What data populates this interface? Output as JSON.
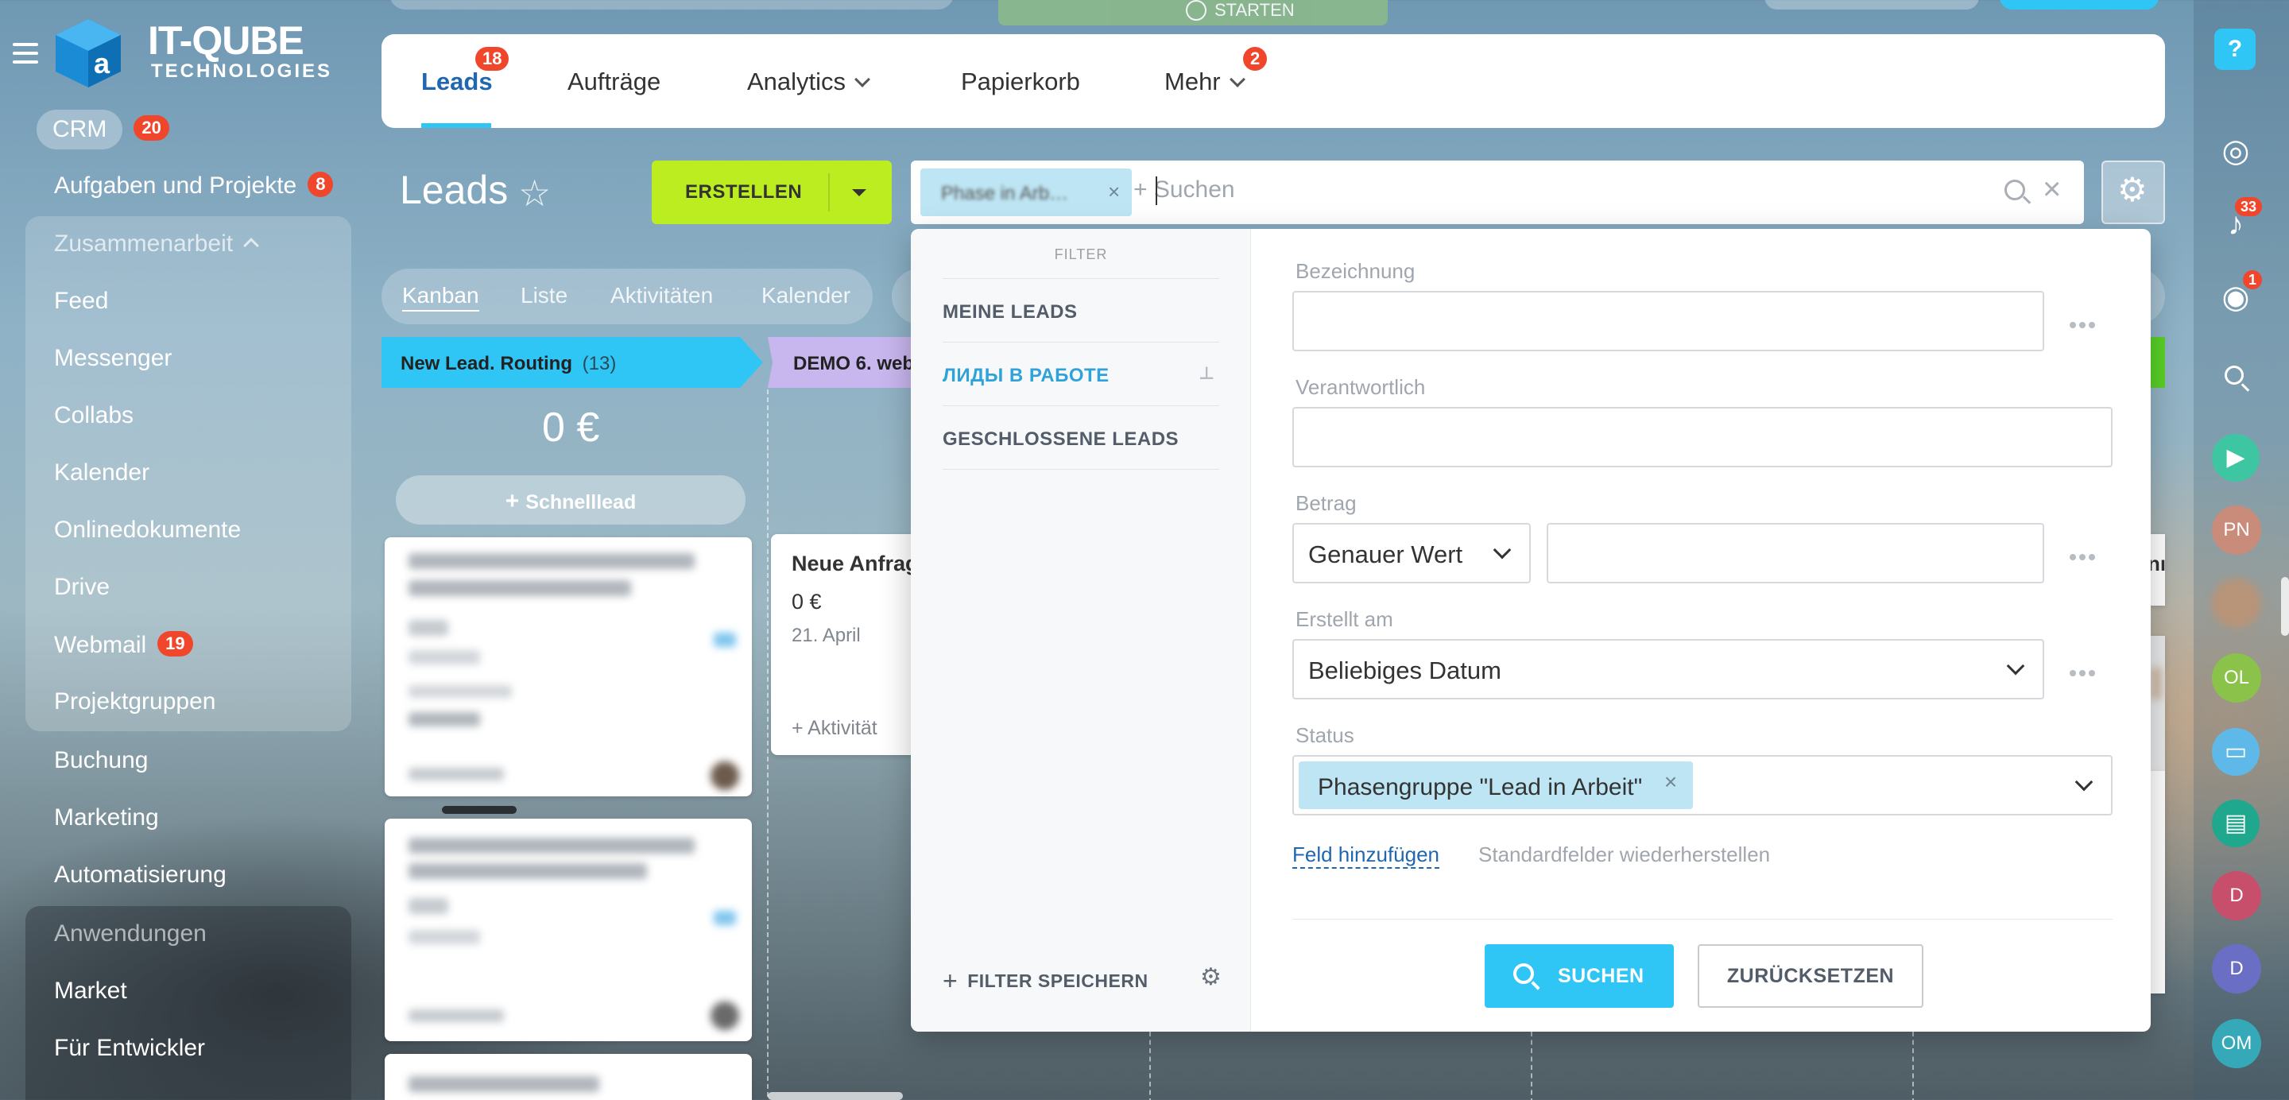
{
  "logo": {
    "name": "IT-QUBE",
    "sub": "TECHNOLOGIES"
  },
  "top_partial": {
    "timer_text": "STARTEN"
  },
  "sidebar": {
    "crm": {
      "label": "CRM",
      "badge": "20"
    },
    "tasks": {
      "label": "Aufgaben und Projekte",
      "badge": "8"
    },
    "group1_title": "Zusammenarbeit",
    "group1": [
      "Feed",
      "Messenger",
      "Collabs",
      "Kalender",
      "Onlinedokumente",
      "Drive"
    ],
    "webmail": {
      "label": "Webmail",
      "badge": "19"
    },
    "projektgruppen": "Projektgruppen",
    "buchung": "Buchung",
    "marketing": "Marketing",
    "automatisierung": "Automatisierung",
    "group2_title": "Anwendungen",
    "market": "Market",
    "entwickler": "Für Entwickler"
  },
  "topnav": {
    "tabs": [
      {
        "label": "Leads",
        "badge": "18"
      },
      {
        "label": "Aufträge"
      },
      {
        "label": "Analytics"
      },
      {
        "label": "Papierkorb"
      },
      {
        "label": "Mehr",
        "badge": "2"
      }
    ]
  },
  "toolbar": {
    "title": "Leads",
    "create_label": "ERSTELLEN",
    "search_chip": "Phase in Arb…",
    "search_placeholder": "+ Suchen"
  },
  "views": {
    "tabs": [
      "Kanban",
      "Liste",
      "Aktivitäten",
      "Kalender"
    ]
  },
  "kanban": {
    "col1": {
      "title": "New Lead. Routing",
      "count": "(13)",
      "sum": "0 €",
      "quick": "Schnelllead"
    },
    "col2": {
      "title": "DEMO 6. web"
    },
    "card2": {
      "title": "Neue Anfrag",
      "amount": "0 €",
      "date": "21. April",
      "activity": "+ Aktivität"
    }
  },
  "filter": {
    "header": "FILTER",
    "presets": [
      "MEINE LEADS",
      "ЛИДЫ В РАБОТЕ",
      "GESCHLOSSENE LEADS"
    ],
    "save_label": "FILTER SPEICHERN",
    "fields": {
      "bezeichnung": "Bezeichnung",
      "verantwortlich": "Verantwortlich",
      "betrag": "Betrag",
      "betrag_select": "Genauer Wert",
      "erstellt": "Erstellt am",
      "erstellt_select": "Beliebiges Datum",
      "status": "Status",
      "status_chip": "Phasengruppe \"Lead in Arbeit\""
    },
    "add_field": "Feld hinzufügen",
    "restore_fields": "Standardfelder wiederherstellen",
    "search_button": "SUCHEN",
    "reset_button": "ZURÜCKSETZEN"
  },
  "right_bar": {
    "notifications_badge": "33",
    "chat_badge": "1",
    "avatars": [
      "PN",
      "OL",
      "D",
      "D",
      "OM"
    ]
  },
  "colors": {
    "accent": "#2fc6f6",
    "create": "#bbed21",
    "badge": "#f0462b",
    "link": "#2067b0"
  }
}
